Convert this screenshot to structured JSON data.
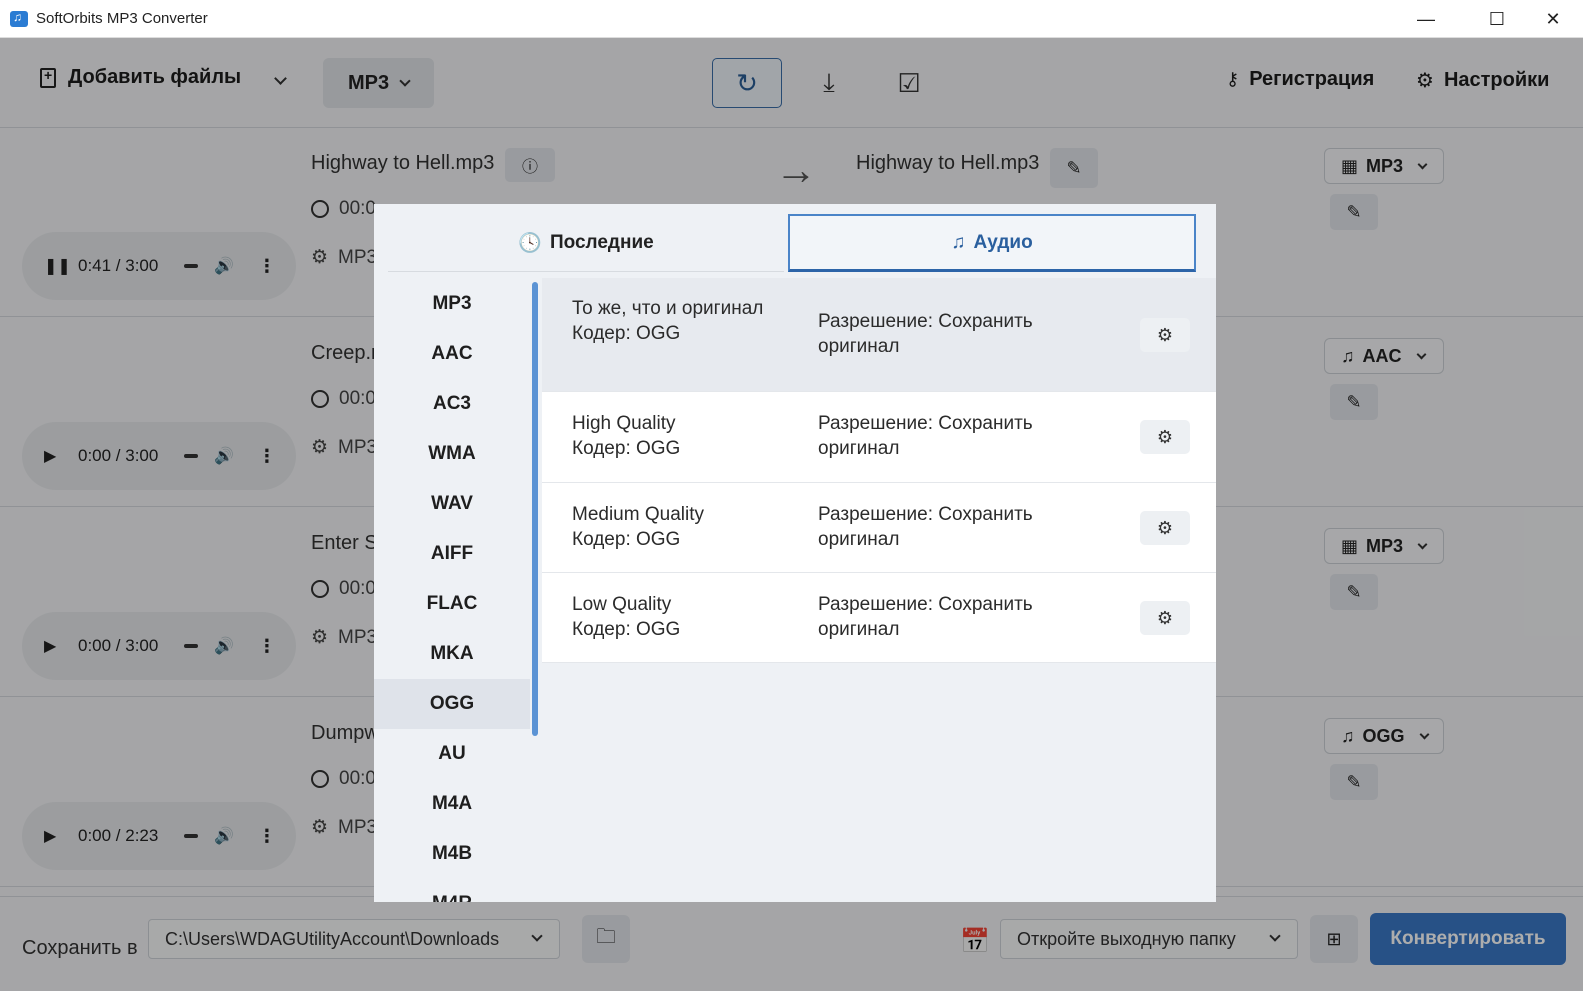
{
  "window": {
    "title": "SoftOrbits MP3 Converter",
    "minimize": "—",
    "maximize": "☐",
    "close": "✕"
  },
  "toolbar": {
    "add_files": "Добавить файлы",
    "format": "MP3",
    "register": "Регистрация",
    "settings": "Настройки",
    "icons": [
      "refresh-icon",
      "download-icon",
      "check-square-icon"
    ]
  },
  "files": [
    {
      "name": "Highway to Hell.mp3",
      "duration": "00:0",
      "codec": "MP3",
      "player_time": "0:41 / 3:00",
      "playing": true,
      "output_name": "Highway to Hell.mp3",
      "output_format": "MP3",
      "format_icon": "film-icon"
    },
    {
      "name": "Creep.m",
      "duration": "00:0",
      "codec": "MP3",
      "player_time": "0:00 / 3:00",
      "playing": false,
      "output_name": "",
      "output_format": "AAC",
      "format_icon": "music-note-icon"
    },
    {
      "name": "Enter S",
      "duration": "00:0",
      "codec": "MP3",
      "player_time": "0:00 / 3:00",
      "playing": false,
      "output_name": "",
      "output_format": "MP3",
      "format_icon": "film-icon"
    },
    {
      "name": "Dumpw",
      "duration": "00:0",
      "codec": "MP3",
      "player_time": "0:00 / 2:23",
      "playing": false,
      "output_name": "",
      "output_format": "OGG",
      "format_icon": "music-note-icon"
    }
  ],
  "bottom": {
    "save_label": "Сохранить в",
    "path": "C:\\Users\\WDAGUtilityAccount\\Downloads",
    "open_folder": "Откройте выходную папку",
    "convert": "Конвертировать"
  },
  "dialog": {
    "tabs": [
      {
        "label": "Последние",
        "icon": "clock-icon",
        "active": false
      },
      {
        "label": "Аудио",
        "icon": "music-note-icon",
        "active": true
      }
    ],
    "formats": [
      "MP3",
      "AAC",
      "AC3",
      "WMA",
      "WAV",
      "AIFF",
      "FLAC",
      "MKA",
      "OGG",
      "AU",
      "M4A",
      "M4B",
      "M4R"
    ],
    "selected_format": "OGG",
    "presets": [
      {
        "name": "То же, что и оригинал",
        "codec": "Кодер: OGG",
        "resolution": "Разрешение: Сохранить оригинал",
        "selected": true
      },
      {
        "name": "High Quality",
        "codec": "Кодер: OGG",
        "resolution": "Разрешение: Сохранить оригинал",
        "selected": false
      },
      {
        "name": "Medium Quality",
        "codec": "Кодер: OGG",
        "resolution": "Разрешение: Сохранить оригинал",
        "selected": false
      },
      {
        "name": "Low Quality",
        "codec": "Кодер: OGG",
        "resolution": "Разрешение: Сохранить оригинал",
        "selected": false
      }
    ]
  }
}
